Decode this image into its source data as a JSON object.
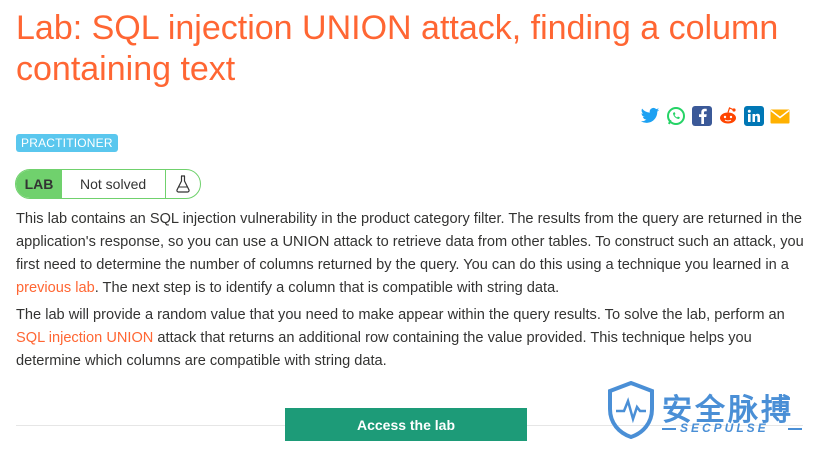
{
  "title": "Lab: SQL injection UNION attack, finding a column containing text",
  "share": {
    "icons": [
      "twitter-icon",
      "whatsapp-icon",
      "facebook-icon",
      "reddit-icon",
      "linkedin-icon",
      "email-icon"
    ]
  },
  "level_badge": "PRACTITIONER",
  "status": {
    "lab_label": "LAB",
    "status_text": "Not solved"
  },
  "paragraph1": {
    "before": "This lab contains an SQL injection vulnerability in the product category filter. The results from the query are returned in the application's response, so you can use a UNION attack to retrieve data from other tables. To construct such an attack, you first need to determine the number of columns returned by the query. You can do this using a technique you learned in a ",
    "link": "previous lab",
    "after": ". The next step is to identify a column that is compatible with string data."
  },
  "paragraph2": {
    "before": "The lab will provide a random value that you need to make appear within the query results. To solve the lab, perform an ",
    "link": "SQL injection UNION",
    "after": " attack that returns an additional row containing the value provided. This technique helps you determine which columns are compatible with string data."
  },
  "access_button": "Access the lab",
  "watermark": {
    "cn": "安全脉搏",
    "en": "SECPULSE"
  },
  "colors": {
    "accent": "#ff6633",
    "button": "#1d9b78",
    "badge": "#5ac7ee",
    "status_green": "#70d16d"
  }
}
